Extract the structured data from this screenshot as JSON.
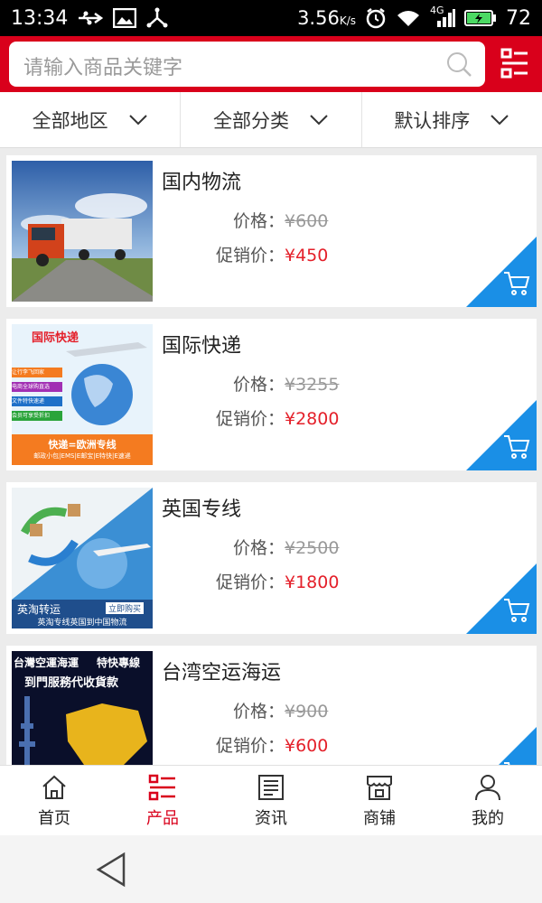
{
  "status_bar": {
    "time": "13:34",
    "speed": "3.56",
    "speed_unit": "K/s",
    "network": "4G",
    "battery": "72"
  },
  "search": {
    "placeholder": "请输入商品关键字"
  },
  "filters": [
    {
      "label": "全部地区"
    },
    {
      "label": "全部分类"
    },
    {
      "label": "默认排序"
    }
  ],
  "products": [
    {
      "name": "国内物流",
      "price_label": "价格：",
      "price": "¥600",
      "sale_label": "促销价：",
      "sale_price": "¥450"
    },
    {
      "name": "国际快递",
      "price_label": "价格：",
      "price": "¥3255",
      "sale_label": "促销价：",
      "sale_price": "¥2800",
      "thumb_text": {
        "title": "国际快递",
        "tag1": "让行李飞回家",
        "tag2": "电商全球购直选",
        "tag3": "文件特快速递",
        "tag4": "会员可享受折扣",
        "banner1": "快递=欧洲专线",
        "banner2": "邮政小包|EMS|E邮宝|E特快|E速递"
      }
    },
    {
      "name": "英国专线",
      "price_label": "价格：",
      "price": "¥2500",
      "sale_label": "促销价：",
      "sale_price": "¥1800",
      "thumb_text": {
        "title": "英淘转运",
        "button": "立即购买",
        "caption": "英淘专线英国到中国物流"
      }
    },
    {
      "name": "台湾空运海运",
      "price_label": "价格：",
      "price": "¥900",
      "sale_label": "促销价：",
      "sale_price": "¥600",
      "thumb_text": {
        "line1": "台灣空運海運",
        "line2": "特快專線",
        "line3": "到門服務代收貨款"
      }
    }
  ],
  "bottom_nav": [
    {
      "label": "首页",
      "icon": "home-icon"
    },
    {
      "label": "产品",
      "icon": "list-icon",
      "active": true
    },
    {
      "label": "资讯",
      "icon": "news-icon"
    },
    {
      "label": "商铺",
      "icon": "shop-icon"
    },
    {
      "label": "我的",
      "icon": "user-icon"
    }
  ],
  "colors": {
    "brand": "#d9001b",
    "sale_price": "#e4202a",
    "cart_corner": "#1a8fe6"
  }
}
